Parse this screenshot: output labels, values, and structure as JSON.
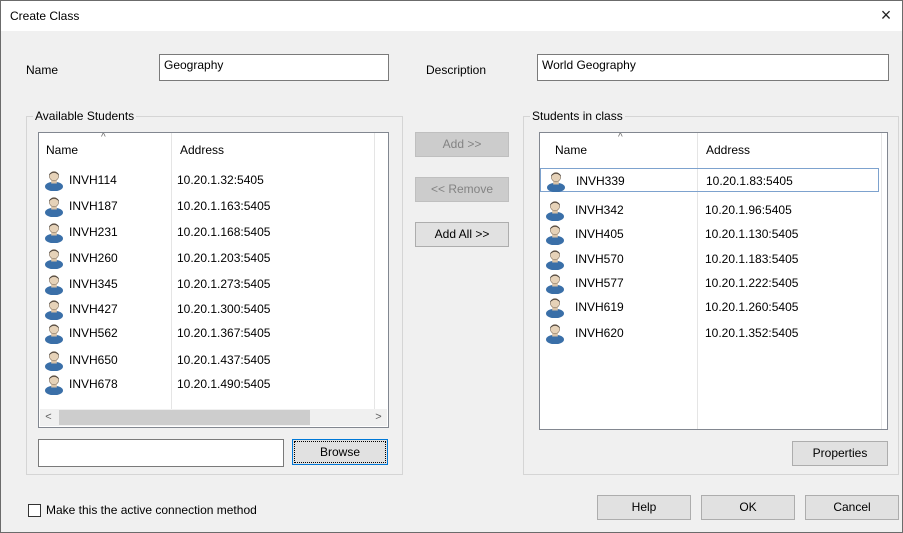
{
  "window": {
    "title": "Create Class",
    "close_glyph": "×"
  },
  "name_label": "Name",
  "name_value": "Geography",
  "description_label": "Description",
  "description_value": "World Geography",
  "available": {
    "group_title": "Available Students",
    "columns": [
      "Name",
      "Address"
    ],
    "sort_glyph": "^",
    "rows": [
      {
        "name": "INVH114",
        "address": "10.20.1.32:5405"
      },
      {
        "name": "INVH187",
        "address": "10.20.1.163:5405"
      },
      {
        "name": "INVH231",
        "address": "10.20.1.168:5405"
      },
      {
        "name": "INVH260",
        "address": "10.20.1.203:5405"
      },
      {
        "name": "INVH345",
        "address": "10.20.1.273:5405"
      },
      {
        "name": "INVH427",
        "address": "10.20.1.300:5405"
      },
      {
        "name": "INVH562",
        "address": "10.20.1.367:5405"
      },
      {
        "name": "INVH650",
        "address": "10.20.1.437:5405"
      },
      {
        "name": "INVH678",
        "address": "10.20.1.490:5405"
      }
    ],
    "scroll_left": "<",
    "scroll_right": ">",
    "browse_value": "",
    "browse_label": "Browse"
  },
  "buttons": {
    "add": "Add >>",
    "remove": "<< Remove",
    "add_all": "Add All >>",
    "properties": "Properties",
    "help": "Help",
    "ok": "OK",
    "cancel": "Cancel"
  },
  "in_class": {
    "group_title": "Students in class",
    "columns": [
      "Name",
      "Address"
    ],
    "sort_glyph": "^",
    "rows": [
      {
        "name": "INVH339",
        "address": "10.20.1.83:5405"
      },
      {
        "name": "INVH342",
        "address": "10.20.1.96:5405"
      },
      {
        "name": "INVH405",
        "address": "10.20.1.130:5405"
      },
      {
        "name": "INVH570",
        "address": "10.20.1.183:5405"
      },
      {
        "name": "INVH577",
        "address": "10.20.1.222:5405"
      },
      {
        "name": "INVH619",
        "address": "10.20.1.260:5405"
      },
      {
        "name": "INVH620",
        "address": "10.20.1.352:5405"
      }
    ]
  },
  "active_checkbox_label": "Make this the active connection method",
  "active_checkbox_checked": false,
  "icons": {
    "user": "user-icon",
    "close": "close-icon"
  },
  "colors": {
    "dialog_bg": "#f0f0f0",
    "icon_blue": "#3a6fa8",
    "focus_border": "#0078d7"
  }
}
